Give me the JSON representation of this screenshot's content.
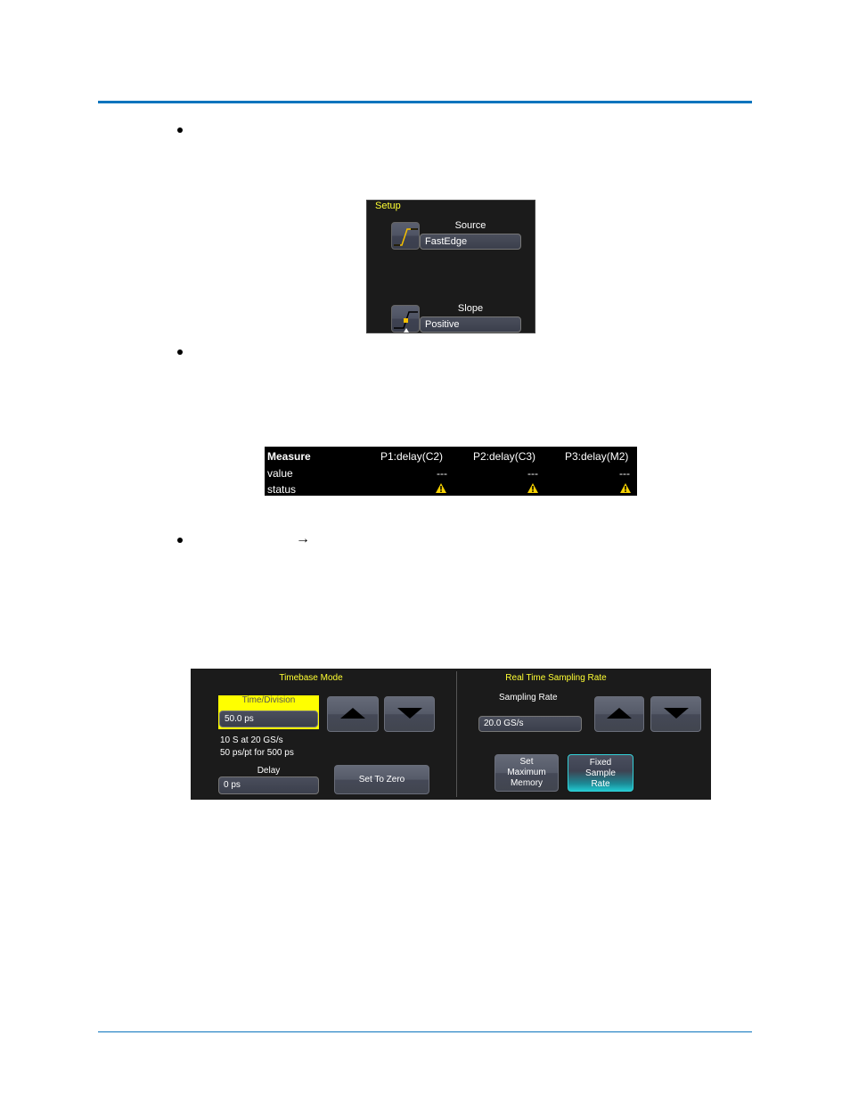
{
  "page": {
    "accent_color": "#0a74bd"
  },
  "bullets": [
    {
      "marker": "•"
    },
    {
      "marker": "•"
    },
    {
      "marker": "•",
      "arrow": "→"
    }
  ],
  "setup_panel": {
    "title": "Setup",
    "source": {
      "label": "Source",
      "value": "FastEdge",
      "icon": "rising-edge-icon"
    },
    "slope": {
      "label": "Slope",
      "value": "Positive",
      "icon": "positive-slope-icon"
    }
  },
  "measure_table": {
    "header": [
      "Measure",
      "P1:delay(C2)",
      "P2:delay(C3)",
      "P3:delay(M2)"
    ],
    "rows": [
      {
        "label": "value",
        "cells": [
          "---",
          "---",
          "---"
        ]
      },
      {
        "label": "status",
        "cells": [
          "warning-icon",
          "warning-icon",
          "warning-icon"
        ]
      }
    ]
  },
  "timebase_panel": {
    "timebase_mode": {
      "title": "Timebase Mode",
      "time_division_label": "Time/Division",
      "time_division_value": "50.0 ps",
      "info_line1": "10 S at 20 GS/s",
      "info_line2": "50 ps/pt for 500 ps",
      "delay_label": "Delay",
      "delay_value": "0 ps",
      "set_to_zero": "Set To Zero",
      "up_icon": "up-arrow-icon",
      "down_icon": "down-arrow-icon"
    },
    "sampling": {
      "title": "Real Time Sampling Rate",
      "rate_label": "Sampling Rate",
      "rate_value": "20.0 GS/s",
      "set_max_line1": "Set",
      "set_max_line2": "Maximum",
      "set_max_line3": "Memory",
      "fixed_line1": "Fixed",
      "fixed_line2": "Sample",
      "fixed_line3": "Rate"
    },
    "colors": {
      "highlight": "#ffff00",
      "title": "#ffff33",
      "active": "#22c7cf"
    }
  }
}
